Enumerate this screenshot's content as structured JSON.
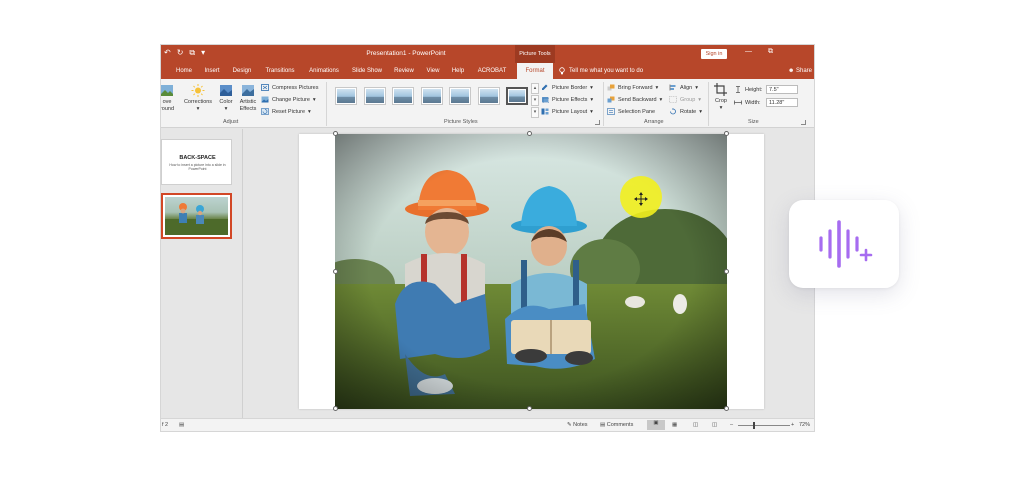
{
  "titlebar": {
    "qat": [
      "↶",
      "↻",
      "⧉",
      "▾"
    ],
    "doc_title": "Presentation1 - PowerPoint",
    "context_label": "Picture Tools",
    "sign_in": "Sign in",
    "window_controls": [
      "—",
      "⧉"
    ]
  },
  "tabs": [
    "Home",
    "Insert",
    "Design",
    "Transitions",
    "Animations",
    "Slide Show",
    "Review",
    "View",
    "Help",
    "ACROBAT",
    "Format"
  ],
  "active_tab": "Format",
  "tell_me": "Tell me what you want to do",
  "share": "Share",
  "ribbon": {
    "adjust": {
      "remove_bg_line1": "ove",
      "remove_bg_line2": "round",
      "corrections": "Corrections",
      "color": "Color",
      "artistic_line1": "Artistic",
      "artistic_line2": "Effects",
      "compress": "Compress Pictures",
      "change": "Change Picture",
      "reset": "Reset Picture",
      "label": "Adjust"
    },
    "styles": {
      "label": "Picture Styles",
      "border": "Picture Border",
      "effects": "Picture Effects",
      "layout": "Picture Layout",
      "gallery_count": 7,
      "selected_index": 6
    },
    "arrange": {
      "bring_forward": "Bring Forward",
      "send_backward": "Send Backward",
      "selection_pane": "Selection Pane",
      "align": "Align",
      "group": "Group",
      "rotate": "Rotate",
      "label": "Arrange"
    },
    "size": {
      "crop": "Crop",
      "height_label": "Height:",
      "height_value": "7.5\"",
      "width_label": "Width:",
      "width_value": "11.28\"",
      "label": "Size"
    }
  },
  "thumbnails": {
    "slide1_title": "BACK-SPACE",
    "slide1_subtitle": "How to insert a picture into a slide in PowerPoint"
  },
  "statusbar": {
    "slide_info": "f 2",
    "notes": "Notes",
    "comments": "Comments",
    "zoom": "72%"
  },
  "colors": {
    "accent": "#b7472a",
    "highlight": "#f2ef1e",
    "fab_icon": "#a66cf0"
  }
}
